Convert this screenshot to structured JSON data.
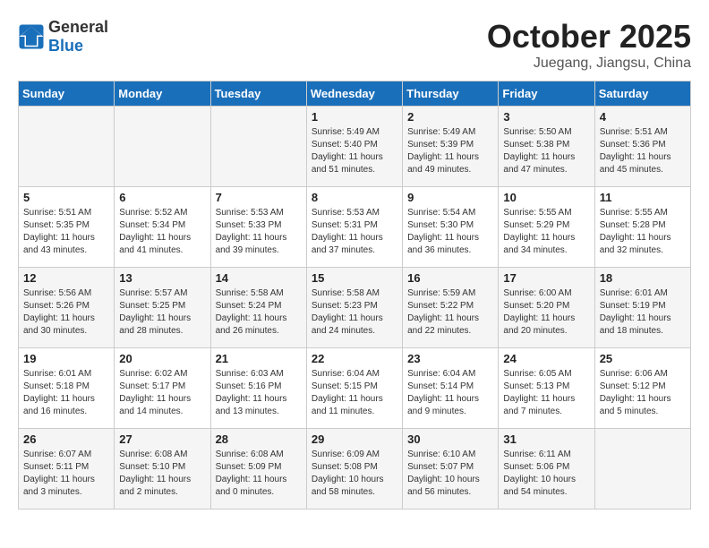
{
  "header": {
    "logo_general": "General",
    "logo_blue": "Blue",
    "month_title": "October 2025",
    "location": "Juegang, Jiangsu, China"
  },
  "weekdays": [
    "Sunday",
    "Monday",
    "Tuesday",
    "Wednesday",
    "Thursday",
    "Friday",
    "Saturday"
  ],
  "weeks": [
    [
      {
        "day": "",
        "info": ""
      },
      {
        "day": "",
        "info": ""
      },
      {
        "day": "",
        "info": ""
      },
      {
        "day": "1",
        "info": "Sunrise: 5:49 AM\nSunset: 5:40 PM\nDaylight: 11 hours\nand 51 minutes."
      },
      {
        "day": "2",
        "info": "Sunrise: 5:49 AM\nSunset: 5:39 PM\nDaylight: 11 hours\nand 49 minutes."
      },
      {
        "day": "3",
        "info": "Sunrise: 5:50 AM\nSunset: 5:38 PM\nDaylight: 11 hours\nand 47 minutes."
      },
      {
        "day": "4",
        "info": "Sunrise: 5:51 AM\nSunset: 5:36 PM\nDaylight: 11 hours\nand 45 minutes."
      }
    ],
    [
      {
        "day": "5",
        "info": "Sunrise: 5:51 AM\nSunset: 5:35 PM\nDaylight: 11 hours\nand 43 minutes."
      },
      {
        "day": "6",
        "info": "Sunrise: 5:52 AM\nSunset: 5:34 PM\nDaylight: 11 hours\nand 41 minutes."
      },
      {
        "day": "7",
        "info": "Sunrise: 5:53 AM\nSunset: 5:33 PM\nDaylight: 11 hours\nand 39 minutes."
      },
      {
        "day": "8",
        "info": "Sunrise: 5:53 AM\nSunset: 5:31 PM\nDaylight: 11 hours\nand 37 minutes."
      },
      {
        "day": "9",
        "info": "Sunrise: 5:54 AM\nSunset: 5:30 PM\nDaylight: 11 hours\nand 36 minutes."
      },
      {
        "day": "10",
        "info": "Sunrise: 5:55 AM\nSunset: 5:29 PM\nDaylight: 11 hours\nand 34 minutes."
      },
      {
        "day": "11",
        "info": "Sunrise: 5:55 AM\nSunset: 5:28 PM\nDaylight: 11 hours\nand 32 minutes."
      }
    ],
    [
      {
        "day": "12",
        "info": "Sunrise: 5:56 AM\nSunset: 5:26 PM\nDaylight: 11 hours\nand 30 minutes."
      },
      {
        "day": "13",
        "info": "Sunrise: 5:57 AM\nSunset: 5:25 PM\nDaylight: 11 hours\nand 28 minutes."
      },
      {
        "day": "14",
        "info": "Sunrise: 5:58 AM\nSunset: 5:24 PM\nDaylight: 11 hours\nand 26 minutes."
      },
      {
        "day": "15",
        "info": "Sunrise: 5:58 AM\nSunset: 5:23 PM\nDaylight: 11 hours\nand 24 minutes."
      },
      {
        "day": "16",
        "info": "Sunrise: 5:59 AM\nSunset: 5:22 PM\nDaylight: 11 hours\nand 22 minutes."
      },
      {
        "day": "17",
        "info": "Sunrise: 6:00 AM\nSunset: 5:20 PM\nDaylight: 11 hours\nand 20 minutes."
      },
      {
        "day": "18",
        "info": "Sunrise: 6:01 AM\nSunset: 5:19 PM\nDaylight: 11 hours\nand 18 minutes."
      }
    ],
    [
      {
        "day": "19",
        "info": "Sunrise: 6:01 AM\nSunset: 5:18 PM\nDaylight: 11 hours\nand 16 minutes."
      },
      {
        "day": "20",
        "info": "Sunrise: 6:02 AM\nSunset: 5:17 PM\nDaylight: 11 hours\nand 14 minutes."
      },
      {
        "day": "21",
        "info": "Sunrise: 6:03 AM\nSunset: 5:16 PM\nDaylight: 11 hours\nand 13 minutes."
      },
      {
        "day": "22",
        "info": "Sunrise: 6:04 AM\nSunset: 5:15 PM\nDaylight: 11 hours\nand 11 minutes."
      },
      {
        "day": "23",
        "info": "Sunrise: 6:04 AM\nSunset: 5:14 PM\nDaylight: 11 hours\nand 9 minutes."
      },
      {
        "day": "24",
        "info": "Sunrise: 6:05 AM\nSunset: 5:13 PM\nDaylight: 11 hours\nand 7 minutes."
      },
      {
        "day": "25",
        "info": "Sunrise: 6:06 AM\nSunset: 5:12 PM\nDaylight: 11 hours\nand 5 minutes."
      }
    ],
    [
      {
        "day": "26",
        "info": "Sunrise: 6:07 AM\nSunset: 5:11 PM\nDaylight: 11 hours\nand 3 minutes."
      },
      {
        "day": "27",
        "info": "Sunrise: 6:08 AM\nSunset: 5:10 PM\nDaylight: 11 hours\nand 2 minutes."
      },
      {
        "day": "28",
        "info": "Sunrise: 6:08 AM\nSunset: 5:09 PM\nDaylight: 11 hours\nand 0 minutes."
      },
      {
        "day": "29",
        "info": "Sunrise: 6:09 AM\nSunset: 5:08 PM\nDaylight: 10 hours\nand 58 minutes."
      },
      {
        "day": "30",
        "info": "Sunrise: 6:10 AM\nSunset: 5:07 PM\nDaylight: 10 hours\nand 56 minutes."
      },
      {
        "day": "31",
        "info": "Sunrise: 6:11 AM\nSunset: 5:06 PM\nDaylight: 10 hours\nand 54 minutes."
      },
      {
        "day": "",
        "info": ""
      }
    ]
  ]
}
